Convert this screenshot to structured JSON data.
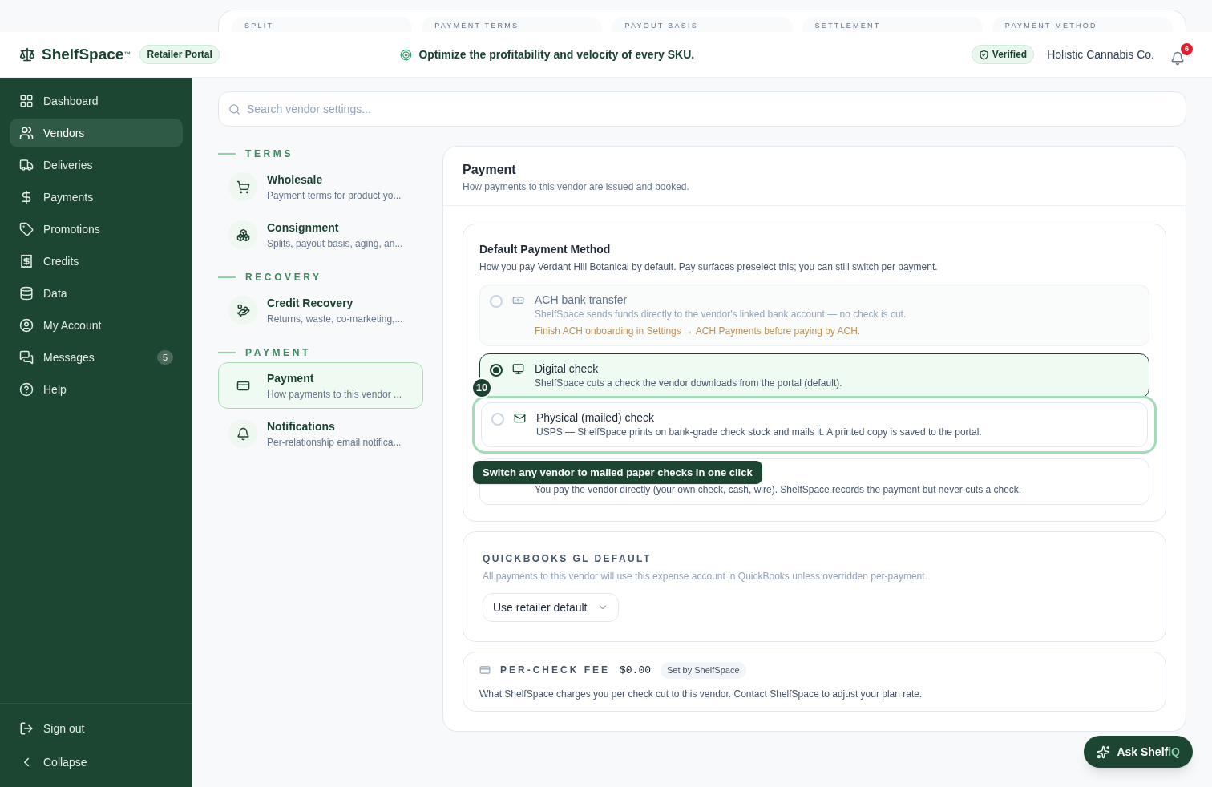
{
  "top_strip": {
    "tabs": [
      "SPLIT",
      "PAYMENT TERMS",
      "PAYOUT BASIS",
      "SETTLEMENT",
      "PAYMENT METHOD"
    ]
  },
  "header": {
    "brand": "ShelfSpace",
    "trademark": "™",
    "portal_badge": "Retailer Portal",
    "tagline": "Optimize the profitability and velocity of every SKU.",
    "verified": "Verified",
    "account": "Holistic Cannabis Co.",
    "notifications": "6"
  },
  "sidebar": {
    "items": [
      {
        "label": "Dashboard",
        "selected": false
      },
      {
        "label": "Vendors",
        "selected": true
      },
      {
        "label": "Deliveries",
        "selected": false
      },
      {
        "label": "Payments",
        "selected": false
      },
      {
        "label": "Promotions",
        "selected": false
      },
      {
        "label": "Credits",
        "selected": false
      },
      {
        "label": "Data",
        "selected": false
      },
      {
        "label": "My Account",
        "selected": false
      },
      {
        "label": "Messages",
        "selected": false,
        "count": "5"
      },
      {
        "label": "Help",
        "selected": false
      }
    ],
    "footer": [
      {
        "label": "Sign out"
      },
      {
        "label": "Collapse"
      }
    ]
  },
  "search": {
    "placeholder": "Search vendor settings..."
  },
  "settings_nav": [
    {
      "heading": "TERMS",
      "items": [
        {
          "title": "Wholesale",
          "subtitle": "Payment terms for product yo...",
          "selected": false
        },
        {
          "title": "Consignment",
          "subtitle": "Splits, payout basis, aging, an...",
          "selected": false
        }
      ]
    },
    {
      "heading": "RECOVERY",
      "items": [
        {
          "title": "Credit Recovery",
          "subtitle": "Returns, waste, co-marketing,...",
          "selected": false
        }
      ]
    },
    {
      "heading": "PAYMENT",
      "items": [
        {
          "title": "Payment",
          "subtitle": "How payments to this vendor ...",
          "selected": true
        },
        {
          "title": "Notifications",
          "subtitle": "Per-relationship email notifica...",
          "selected": false
        }
      ]
    }
  ],
  "panel": {
    "title": "Payment",
    "subtitle": "How payments to this vendor are issued and booked.",
    "method": {
      "title": "Default Payment Method",
      "description": "How you pay Verdant Hill Botanical by default. Pay surfaces preselect this; you can still switch per payment.",
      "options": [
        {
          "title": "ACH bank transfer",
          "description": "ShelfSpace sends funds directly to the vendor's linked bank account — no check is cut.",
          "warning": "Finish ACH onboarding in Settings → ACH Payments before paying by ACH.",
          "selected": false,
          "disabled": true,
          "highlighted": false
        },
        {
          "title": "Digital check",
          "description": "ShelfSpace cuts a check the vendor downloads from the portal (default).",
          "selected": true,
          "disabled": false,
          "highlighted": false
        },
        {
          "title": "Physical (mailed) check",
          "description": "USPS — ShelfSpace prints on bank-grade check stock and mails it. A printed copy is saved to the portal.",
          "selected": false,
          "disabled": false,
          "highlighted": true,
          "callout": "10"
        },
        {
          "description": "You pay the vendor directly (your own check, cash, wire). ShelfSpace records the payment but never cuts a check.",
          "disabled": false,
          "highlighted": false
        }
      ],
      "tooltip": "Switch any vendor to mailed paper checks in one click"
    },
    "quickbooks": {
      "heading": "QUICKBOOKS GL DEFAULT",
      "description": "All payments to this vendor will use this expense account in QuickBooks unless overridden per-payment.",
      "select_value": "Use retailer default"
    },
    "fee": {
      "heading": "PER-CHECK FEE",
      "amount": "$0.00",
      "badge": "Set by ShelfSpace",
      "description": "What ShelfSpace charges you per check cut to this vendor. Contact ShelfSpace to adjust your plan rate."
    }
  },
  "ask_button": {
    "label": "Ask Shelf",
    "accent": "iQ"
  }
}
